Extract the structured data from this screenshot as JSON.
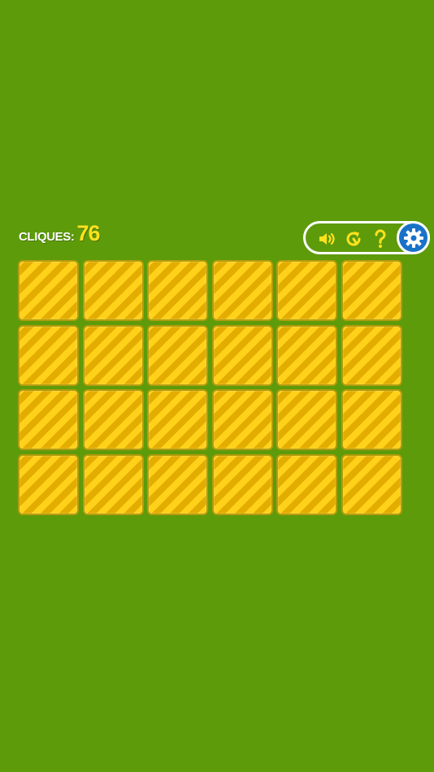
{
  "score": {
    "label": "CLIQUES:",
    "count": "76"
  },
  "controls": [
    {
      "name": "sound",
      "icon": "speaker-icon"
    },
    {
      "name": "restart",
      "icon": "restart-icon"
    },
    {
      "name": "help",
      "icon": "question-icon"
    },
    {
      "name": "settings",
      "icon": "gear-icon"
    }
  ],
  "colors": {
    "background": "#5d9b0b",
    "accent": "#ffe21c",
    "card_stripe_light": "#ffd11a",
    "card_stripe_dark": "#e3ad00",
    "settings_button": "#1a72c8"
  },
  "board": {
    "rows": 4,
    "columns": 6,
    "face_down_cards": 24
  }
}
